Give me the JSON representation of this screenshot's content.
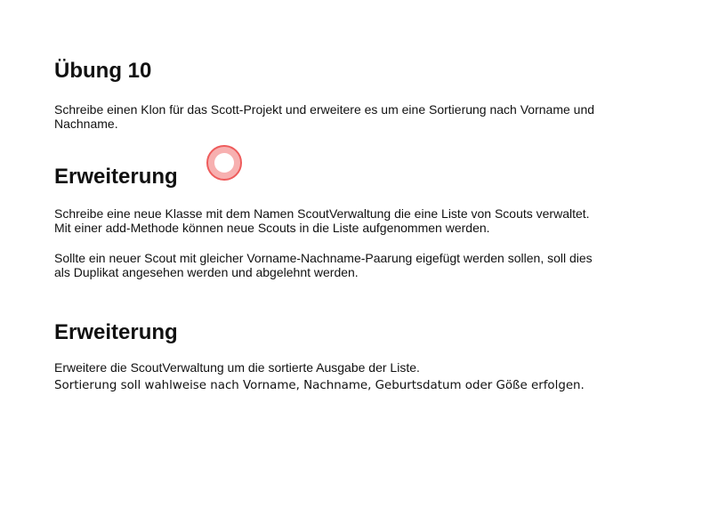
{
  "section1": {
    "title": "Übung 10",
    "text_line1": "Schreibe einen Klon für das Scott-Projekt und erweitere es um eine Sortierung nach Vorname und",
    "text_line2": "Nachname."
  },
  "section2": {
    "title": "Erweiterung",
    "para1_line1": "Schreibe eine neue Klasse mit dem Namen ScoutVerwaltung die eine Liste von Scouts verwaltet.",
    "para1_line2": "Mit einer add-Methode können neue Scouts in die Liste aufgenommen werden.",
    "para2_line1": "Sollte ein neuer Scout mit gleicher Vorname-Nachname-Paarung eigefügt werden sollen, soll dies",
    "para2_line2": "als Duplikat angesehen werden und abgelehnt werden."
  },
  "section3": {
    "title": "Erweiterung",
    "line1": "Erweitere die ScoutVerwaltung um die sortierte Ausgabe der Liste.",
    "line2": "Sortierung soll wahlweise nach Vorname, Nachname, Geburtsdatum oder Göße erfolgen."
  },
  "cursor": {
    "icon": "click-indicator-icon",
    "color": "#ee5c5c"
  }
}
